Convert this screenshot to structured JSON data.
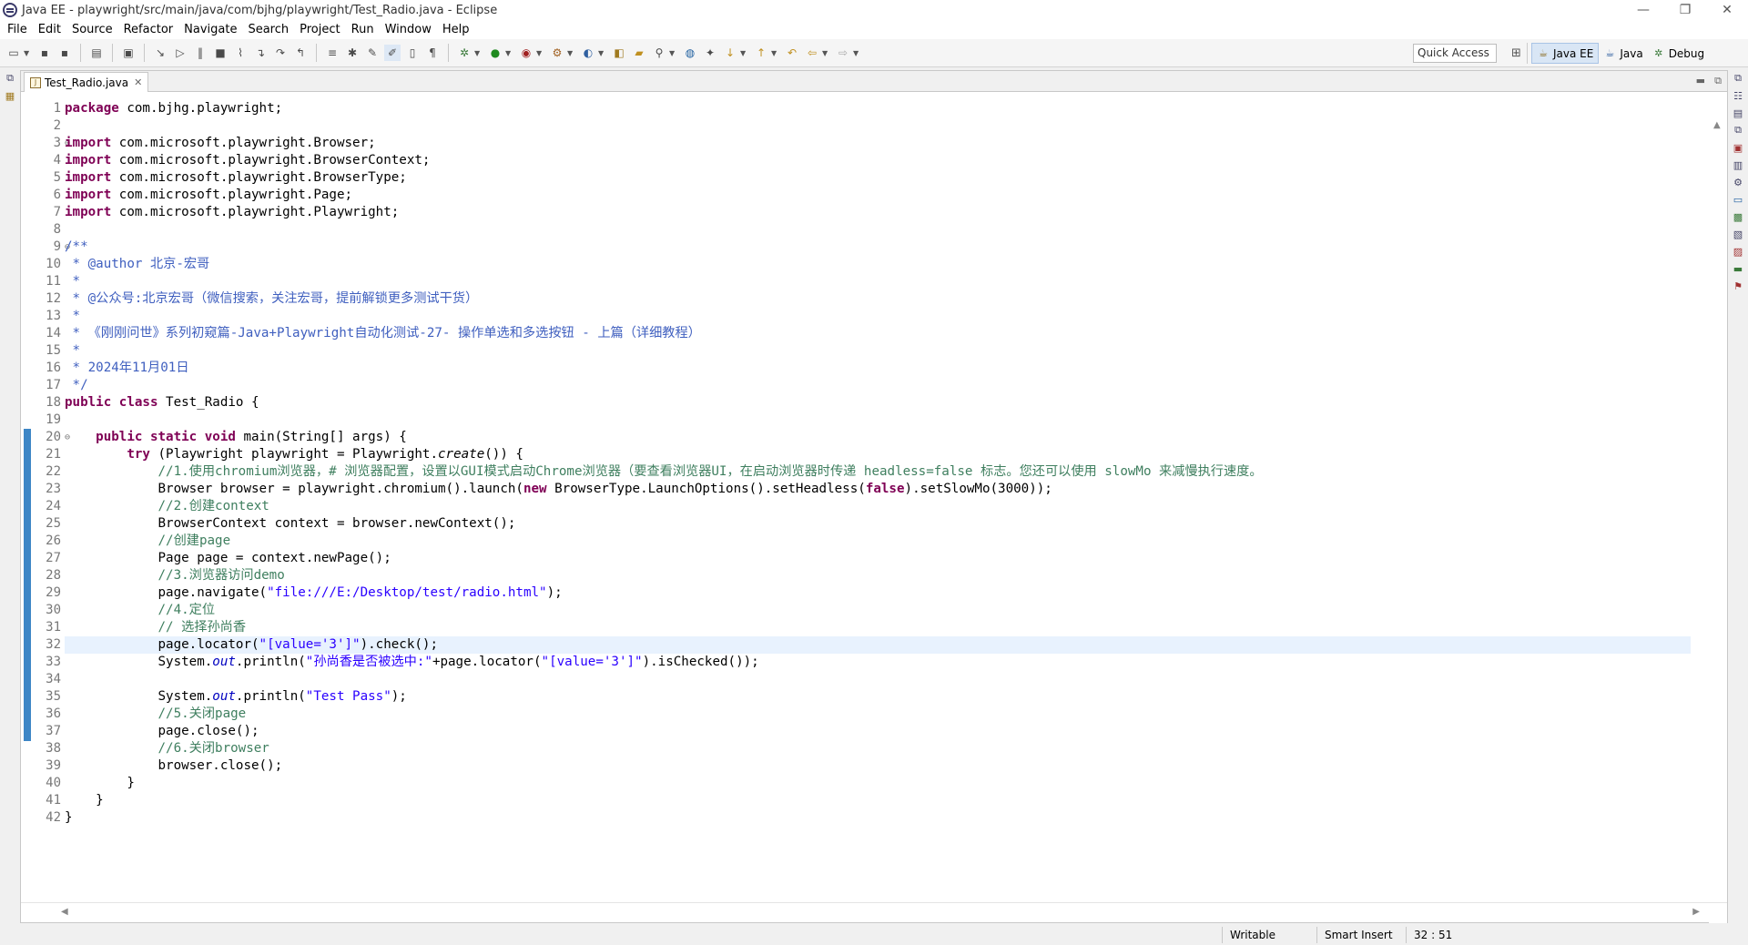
{
  "window": {
    "title": "Java EE - playwright/src/main/java/com/bjhg/playwright/Test_Radio.java - Eclipse",
    "controls": {
      "minimize": "—",
      "restore": "❐",
      "close": "✕"
    }
  },
  "menu": [
    "File",
    "Edit",
    "Source",
    "Refactor",
    "Navigate",
    "Search",
    "Project",
    "Run",
    "Window",
    "Help"
  ],
  "toolbar": {
    "quick_access": "Quick Access",
    "perspectives": [
      {
        "label": "Java EE",
        "active": true
      },
      {
        "label": "Java",
        "active": false
      },
      {
        "label": "Debug",
        "active": false
      }
    ]
  },
  "editor": {
    "tab_label": "Test_Radio.java",
    "line_numbers": [
      "1",
      "2",
      "3",
      "4",
      "5",
      "6",
      "7",
      "8",
      "9",
      "10",
      "11",
      "12",
      "13",
      "14",
      "15",
      "16",
      "17",
      "18",
      "19",
      "20",
      "21",
      "22",
      "23",
      "24",
      "25",
      "26",
      "27",
      "28",
      "29",
      "30",
      "31",
      "32",
      "33",
      "34",
      "35",
      "36",
      "37",
      "38",
      "39",
      "40",
      "41",
      "42"
    ],
    "lines": [
      "package com.bjhg.playwright;",
      "",
      "import com.microsoft.playwright.Browser;",
      "import com.microsoft.playwright.BrowserContext;",
      "import com.microsoft.playwright.BrowserType;",
      "import com.microsoft.playwright.Page;",
      "import com.microsoft.playwright.Playwright;",
      "",
      "/**",
      " * @author 北京-宏哥",
      " *",
      " * @公众号:北京宏哥（微信搜索，关注宏哥，提前解锁更多测试干货）",
      " *",
      " * 《刚刚问世》系列初窥篇-Java+Playwright自动化测试-27- 操作单选和多选按钮 - 上篇（详细教程）",
      " *",
      " * 2024年11月01日",
      " */",
      "public class Test_Radio {",
      "",
      "    public static void main(String[] args) {",
      "        try (Playwright playwright = Playwright.create()) {",
      "            //1.使用chromium浏览器，# 浏览器配置，设置以GUI模式启动Chrome浏览器（要查看浏览器UI，在启动浏览器时传递 headless=false 标志。您还可以使用 slowMo 来减慢执行速度。",
      "            Browser browser = playwright.chromium().launch(new BrowserType.LaunchOptions().setHeadless(false).setSlowMo(3000));",
      "            //2.创建context",
      "            BrowserContext context = browser.newContext();",
      "            //创建page",
      "            Page page = context.newPage();",
      "            //3.浏览器访问demo",
      "            page.navigate(\"file:///E:/Desktop/test/radio.html\");",
      "            //4.定位",
      "            // 选择孙尚香",
      "            page.locator(\"[value='3']\").check();",
      "            System.out.println(\"孙尚香是否被选中:\"+page.locator(\"[value='3']\").isChecked());",
      "",
      "            System.out.println(\"Test Pass\");",
      "            //5.关闭page",
      "            page.close();",
      "            //6.关闭browser",
      "            browser.close();",
      "        }",
      "    }",
      "}"
    ]
  },
  "status": {
    "writable": "Writable",
    "insert_mode": "Smart Insert",
    "position": "32 : 51"
  }
}
